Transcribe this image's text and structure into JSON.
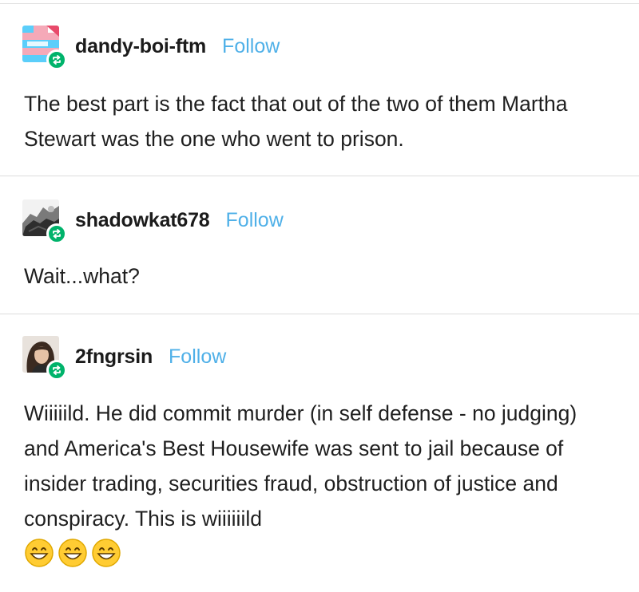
{
  "posts": [
    {
      "username": "dandy-boi-ftm",
      "follow_label": "Follow",
      "avatar_icon": "trans-flag-avatar",
      "reblog_icon": "reblog-icon",
      "text": "The best part is the fact that out of the two of them Martha Stewart was the one who went to prison."
    },
    {
      "username": "shadowkat678",
      "follow_label": "Follow",
      "avatar_icon": "photo-avatar",
      "reblog_icon": "reblog-icon",
      "text": "Wait...what?"
    },
    {
      "username": "2fngrsin",
      "follow_label": "Follow",
      "avatar_icon": "portrait-avatar",
      "reblog_icon": "reblog-icon",
      "text": "Wiiiiild. He did commit murder (in self defense - no judging) and America's Best Housewife was sent to jail because of insider trading, securities fraud, obstruction of justice and conspiracy. This is wiiiiiild",
      "emoji": [
        "grinning-face-emoji",
        "grinning-face-emoji",
        "grinning-face-emoji"
      ]
    }
  ],
  "colors": {
    "follow": "#4fb0e8",
    "reblog_badge": "#00b36b",
    "separator": "#dcdcdc",
    "text": "#1f1f1f"
  }
}
